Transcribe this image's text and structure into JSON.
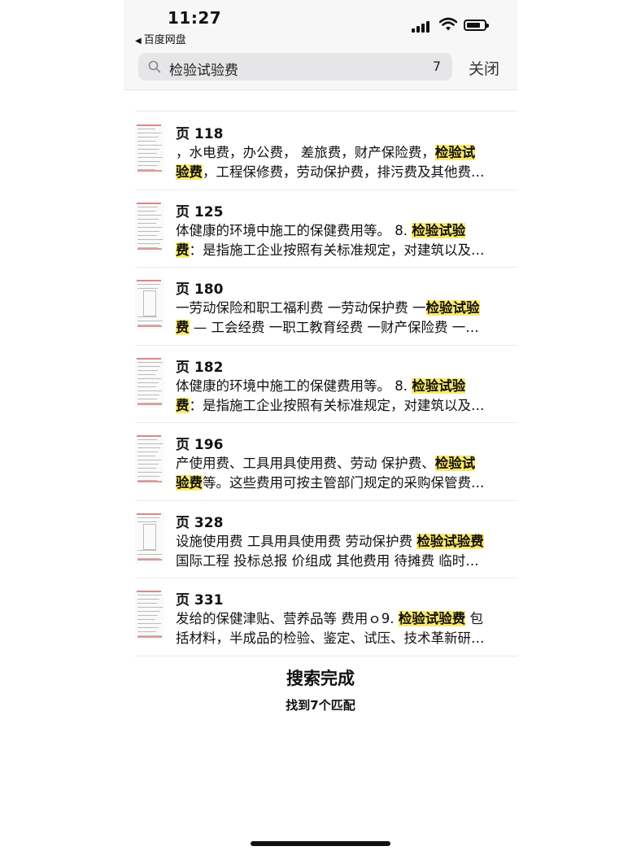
{
  "status": {
    "time": "11:27",
    "back_app": "百度网盘"
  },
  "search": {
    "query": "检验试验费",
    "count": "7",
    "close_label": "关闭"
  },
  "results": [
    {
      "page": "页 118",
      "l1a": "，水电费，办公费， 差旅费，财产保险费，",
      "l1h": "检验试",
      "l1b": "",
      "l2a": "",
      "l2h": "验费",
      "l2b": "，工程保修费，劳动保护费，排污费及其他费…"
    },
    {
      "page": "页 125",
      "l1a": "体健康的环境中施工的保健费用等。 8. ",
      "l1h": "检验试验",
      "l1b": "",
      "l2a": "",
      "l2h": "费",
      "l2b": "：是指施工企业按照有关标准规定，对建筑以及…"
    },
    {
      "page": "页 180",
      "l1a": "一劳动保险和职工福利费 一劳动保护费 一",
      "l1h": "检验试验",
      "l1b": "",
      "l2a": "",
      "l2h": "费",
      "l2b": " — 工会经费 一职工教育经费 一财产保险费 一…"
    },
    {
      "page": "页 182",
      "l1a": "体健康的环境中施工的保健费用等。 8. ",
      "l1h": "检验试验",
      "l1b": "",
      "l2a": "",
      "l2h": "费",
      "l2b": "：是指施工企业按照有关标准规定，对建筑以及…"
    },
    {
      "page": "页 196",
      "l1a": "产使用费、工具用具使用费、劳动 保护费、",
      "l1h": "检验试",
      "l1b": "",
      "l2a": "",
      "l2h": "验费",
      "l2b": "等。这些费用可按主管部门规定的采购保管费…"
    },
    {
      "page": "页 328",
      "l1a": "设施使用费 工具用具使用费 劳动保护费 ",
      "l1h": "检验试验费",
      "l1b": "",
      "l2a": "国际工程 投标总报 价组成 其他费用 待摊费 临时…",
      "l2h": "",
      "l2b": ""
    },
    {
      "page": "页 331",
      "l1a": "发给的保健津贴、营养品等 费用ｏ9. ",
      "l1h": "检验试验费",
      "l1b": " 包",
      "l2a": "括材料，半成品的检验、鉴定、试压、技术革新研…",
      "l2h": "",
      "l2b": ""
    }
  ],
  "footer": {
    "title": "搜索完成",
    "subtitle": "找到7个匹配"
  }
}
